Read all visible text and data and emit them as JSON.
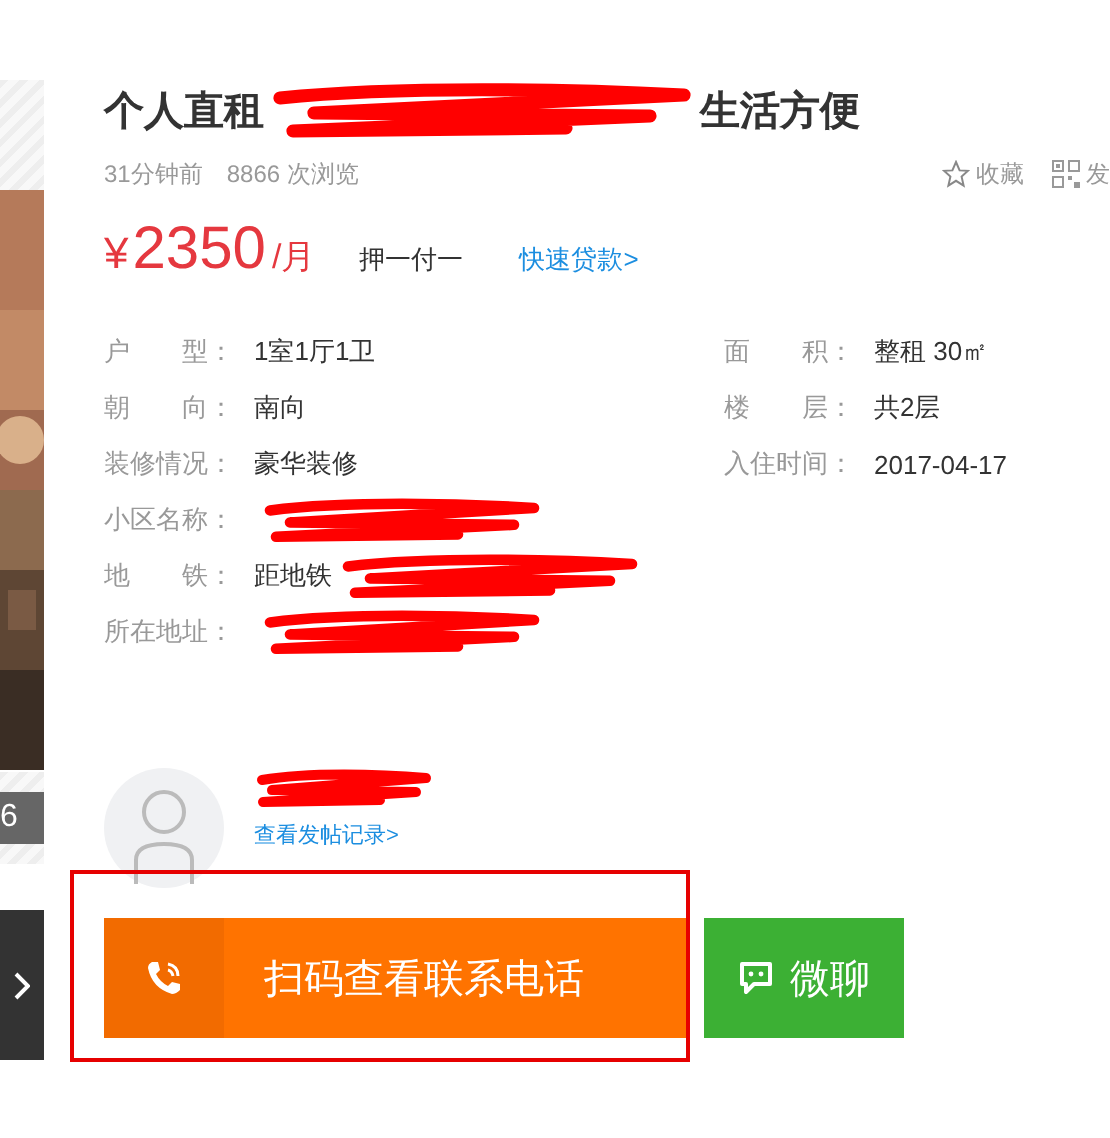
{
  "gallery": {
    "count": "6"
  },
  "title": {
    "start": "个人直租",
    "end": "生活方便",
    "redacted": true
  },
  "meta": {
    "posted": "31分钟前",
    "views": "8866 次浏览"
  },
  "actions": [
    {
      "kind": "star",
      "label": "收藏"
    },
    {
      "kind": "qr",
      "label": "发"
    }
  ],
  "price": {
    "currency": "¥",
    "amount": "2350",
    "unit": "/月",
    "deposit": "押一付一",
    "loan_link": "快速贷款>"
  },
  "details_left": [
    {
      "label": "户　　型：",
      "value": "1室1厅1卫",
      "redacted": false
    },
    {
      "label": "朝　　向：",
      "value": "南向",
      "redacted": false
    },
    {
      "label": "装修情况：",
      "value": "豪华装修",
      "redacted": false
    },
    {
      "label": "小区名称：",
      "redacted": true
    },
    {
      "label": "地　　铁：",
      "value": "距地铁",
      "redacted": true
    },
    {
      "label": "所在地址：",
      "redacted": true
    }
  ],
  "details_right": [
    {
      "label": "面　　积：",
      "value": "整租  30㎡",
      "redacted": false
    },
    {
      "label": "楼　　层：",
      "value": "共2层",
      "redacted": false
    },
    {
      "label": "入住时间：",
      "value": "2017-04-17",
      "redacted": false
    }
  ],
  "landlord": {
    "name_redacted": true,
    "history_link": "查看发帖记录>"
  },
  "buttons": [
    {
      "kind": "phone",
      "label": "扫码查看联系电话",
      "highlighted": true
    },
    {
      "kind": "chat",
      "label": "微聊",
      "highlighted": false
    }
  ]
}
